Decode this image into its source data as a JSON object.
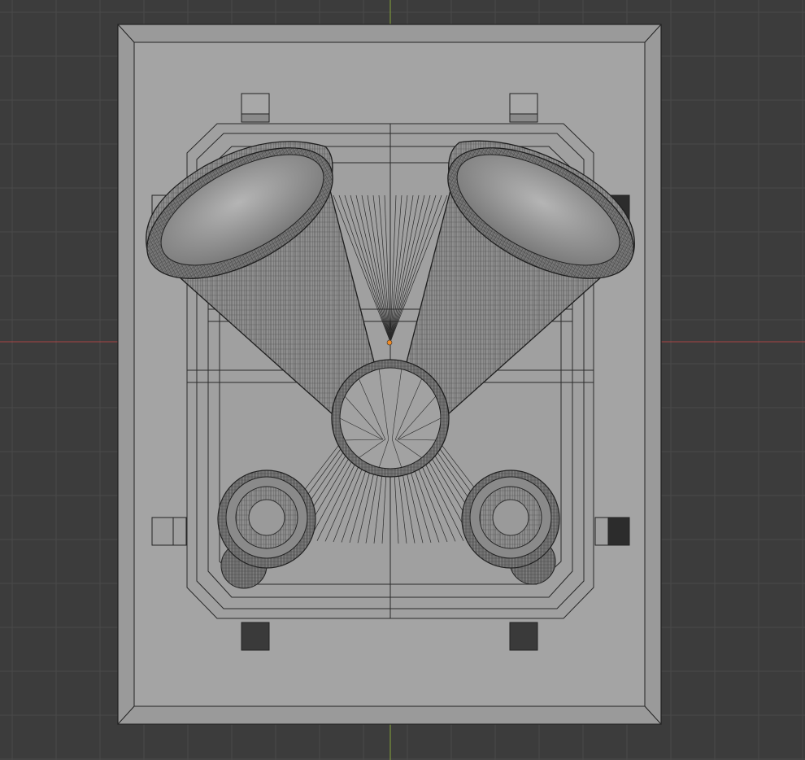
{
  "viewport": {
    "background": "#3c3c3c",
    "grid_color": "#4a4a4a",
    "x_axis_color": "#b04848",
    "y_axis_color": "#8aa83a",
    "model_fill": "#9c9c9c",
    "wire_color": "#1e1e1e",
    "origin_color": "#f08a24"
  },
  "model": {
    "name": "",
    "parts": [
      "base-plate",
      "inner-frame",
      "left-horn",
      "right-horn",
      "center-ring",
      "left-speaker",
      "right-speaker",
      "mounting-tabs"
    ]
  }
}
